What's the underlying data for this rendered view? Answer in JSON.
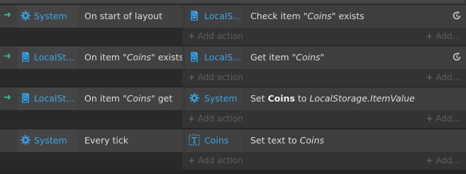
{
  "events": [
    {
      "condition_object": "System",
      "condition_icon": "gear-icon",
      "condition_text": "On start of layout",
      "condition_object_text": "",
      "condition_suffix": "",
      "action_object": "LocalS...",
      "action_icon": "local-storage-icon",
      "action_prefix": "Check item ",
      "action_italic": "\"Coins\"",
      "action_bold": "",
      "action_suffix": " exists",
      "has_refresh": true,
      "has_trigger_arrow": true
    },
    {
      "condition_object": "LocalSt...",
      "condition_icon": "local-storage-icon",
      "condition_text": "On item ",
      "condition_object_text": "\"Coins\"",
      "condition_suffix": " exists",
      "action_object": "LocalS...",
      "action_icon": "local-storage-icon",
      "action_prefix": "Get item ",
      "action_italic": "\"Coins\"",
      "action_bold": "",
      "action_suffix": "",
      "has_refresh": true,
      "has_trigger_arrow": true
    },
    {
      "condition_object": "LocalSt...",
      "condition_icon": "local-storage-icon",
      "condition_text": "On item ",
      "condition_object_text": "\"Coins\"",
      "condition_suffix": " get",
      "action_object": "System",
      "action_icon": "gear-icon",
      "action_prefix": "Set ",
      "action_bold": "Coins",
      "action_mid": " to ",
      "action_italic": "LocalStorage.ItemValue",
      "action_suffix": "",
      "has_refresh": false,
      "has_trigger_arrow": true
    },
    {
      "condition_object": "System",
      "condition_icon": "gear-icon",
      "condition_text": "Every tick",
      "condition_object_text": "",
      "condition_suffix": "",
      "action_object": "Coins",
      "action_icon": "text-object-icon",
      "action_prefix": "Set text to ",
      "action_italic": "Coins",
      "action_bold": "",
      "action_suffix": "",
      "has_refresh": false,
      "has_trigger_arrow": false
    }
  ],
  "labels": {
    "add_action": "Add action",
    "add_more": "Add...",
    "plus": "+",
    "arrow": "➜"
  },
  "colors": {
    "object_name": "#3da5e8",
    "trigger_arrow": "#35c27c",
    "text": "#dcdcdc"
  }
}
